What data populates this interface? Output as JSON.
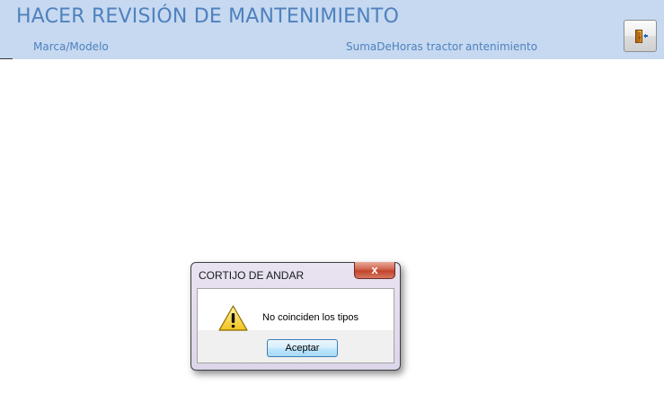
{
  "form": {
    "title": "HACER REVISIÓN DE MANTENIMIENTO",
    "columns": {
      "marca_modelo": "Marca/Modelo",
      "suma_horas": "SumaDeHoras tractor",
      "mantenimiento_fragment": "antenimiento"
    },
    "exit_button_icon": "exit-door-icon",
    "colors": {
      "header_bg": "#c6d9f1",
      "header_text": "#4f81bd"
    }
  },
  "dialog": {
    "title": "CORTIJO DE ANDAR",
    "close_label": "x",
    "icon": "warning-icon",
    "message": "No coinciden los tipos",
    "ok_label": "Aceptar"
  }
}
